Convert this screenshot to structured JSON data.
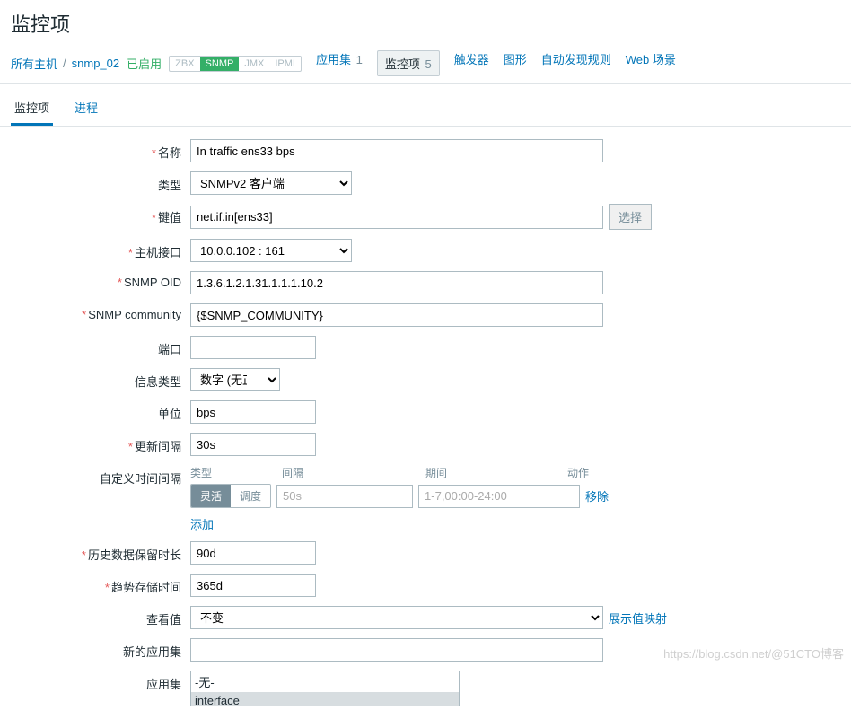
{
  "page": {
    "title": "监控项"
  },
  "breadcrumb": {
    "all_hosts": "所有主机",
    "host": "snmp_02",
    "enabled": "已启用"
  },
  "tags": {
    "zbx": "ZBX",
    "snmp": "SNMP",
    "jmx": "JMX",
    "ipmi": "IPMI"
  },
  "nav": {
    "apps": {
      "label": "应用集",
      "count": "1"
    },
    "items": {
      "label": "监控项",
      "count": "5"
    },
    "triggers": {
      "label": "触发器"
    },
    "graphs": {
      "label": "图形"
    },
    "discovery": {
      "label": "自动发现规则"
    },
    "web": {
      "label": "Web 场景"
    }
  },
  "tabs": {
    "item": "监控项",
    "process": "进程"
  },
  "labels": {
    "name": "名称",
    "type": "类型",
    "key": "键值",
    "interface": "主机接口",
    "snmp_oid": "SNMP OID",
    "community": "SNMP community",
    "port": "端口",
    "info_type": "信息类型",
    "units": "单位",
    "update": "更新间隔",
    "custom_int": "自定义时间间隔",
    "history": "历史数据保留时长",
    "trends": "趋势存储时间",
    "show_value": "查看值",
    "new_app": "新的应用集",
    "applications": "应用集"
  },
  "values": {
    "name": "In traffic ens33 bps",
    "type": "SNMPv2 客户端",
    "key": "net.if.in[ens33]",
    "interface": "10.0.0.102 : 161",
    "snmp_oid": "1.3.6.1.2.1.31.1.1.1.10.2",
    "community": "{$SNMP_COMMUNITY}",
    "port": "",
    "info_type": "数字 (无正负)",
    "units": "bps",
    "update": "30s",
    "history": "90d",
    "trends": "365d",
    "show_value": "不变",
    "new_app": ""
  },
  "custom_interval": {
    "head_type": "类型",
    "head_interval": "间隔",
    "head_period": "期间",
    "head_action": "动作",
    "flexible": "灵活",
    "scheduling": "调度",
    "interval": "50s",
    "period": "1-7,00:00-24:00",
    "remove": "移除",
    "add": "添加"
  },
  "buttons": {
    "select": "选择"
  },
  "links": {
    "show_mapping": "展示值映射"
  },
  "app_list": {
    "none": "-无-",
    "opt1": "interface"
  },
  "watermark": "https://blog.csdn.net/@51CTO博客"
}
